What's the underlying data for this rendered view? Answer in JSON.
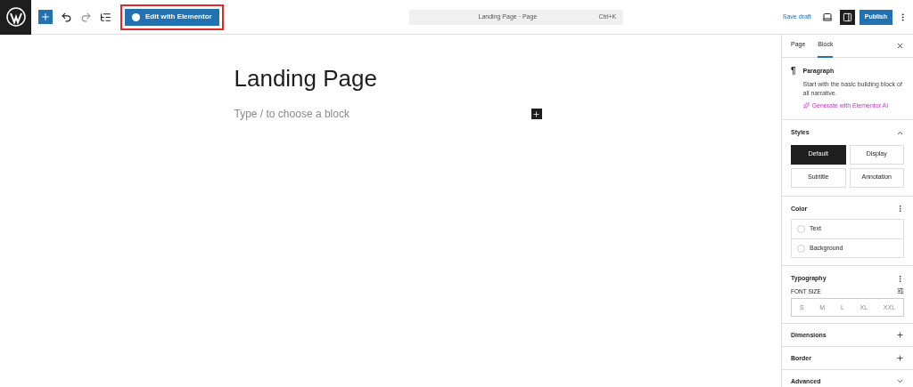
{
  "toolbar": {
    "edit_button": "Edit with Elementor",
    "highlighted": true,
    "command_bar": {
      "title": "Landing Page · Page",
      "shortcut": "Ctrl+K"
    },
    "save_draft": "Save draft",
    "settings_selected": true,
    "publish": "Publish"
  },
  "editor": {
    "title": "Landing Page",
    "placeholder": "Type / to choose a block"
  },
  "sidebar": {
    "tabs": [
      {
        "label": "Page",
        "selected": false
      },
      {
        "label": "Block",
        "selected": true
      }
    ],
    "block": {
      "symbol": "¶",
      "name": "Paragraph",
      "description": "Start with the basic building block of all narrative.",
      "ai_link": "Generate with Elementor AI"
    },
    "styles": {
      "title": "Styles",
      "expanded": true,
      "options": [
        {
          "label": "Default",
          "selected": true
        },
        {
          "label": "Display",
          "selected": false
        },
        {
          "label": "Subtitle",
          "selected": false
        },
        {
          "label": "Annotation",
          "selected": false
        }
      ]
    },
    "color": {
      "title": "Color",
      "items": [
        "Text",
        "Background"
      ]
    },
    "typography": {
      "title": "Typography",
      "font_size_label": "FONT SIZE",
      "sizes": [
        "S",
        "M",
        "L",
        "XL",
        "XXL"
      ]
    },
    "panels": [
      {
        "title": "Dimensions",
        "kind": "add"
      },
      {
        "title": "Border",
        "kind": "add"
      },
      {
        "title": "Advanced",
        "kind": "expand"
      }
    ]
  }
}
